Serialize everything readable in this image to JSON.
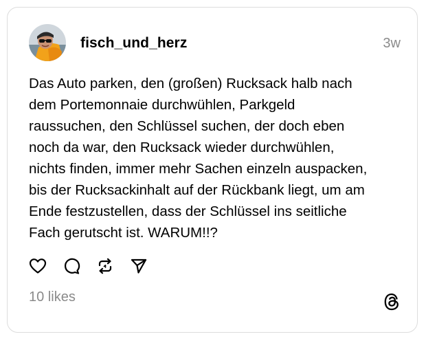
{
  "post": {
    "username": "fisch_und_herz",
    "timestamp": "3w",
    "text_lines": [
      "Das Auto parken, den (großen) Rucksack halb nach",
      "dem Portemonnaie durchwühlen, Parkgeld",
      "raussuchen, den Schlüssel suchen, der doch eben",
      "noch da war, den Rucksack wieder durchwühlen,",
      "nichts finden, immer mehr Sachen einzeln auspacken,",
      "bis der Rucksackinhalt auf der Rückbank liegt, um am",
      "Ende festzustellen, dass der Schlüssel ins seitliche",
      "Fach gerutscht ist. WARUM!!?"
    ],
    "likes": "10 likes"
  },
  "icons": {
    "like": "heart-icon",
    "reply": "speech-bubble-icon",
    "repost": "repost-icon",
    "share": "send-icon",
    "brand": "threads-logo-icon"
  },
  "colors": {
    "text": "#000000",
    "muted": "#8a8a8a",
    "border": "#dcdcdc"
  }
}
